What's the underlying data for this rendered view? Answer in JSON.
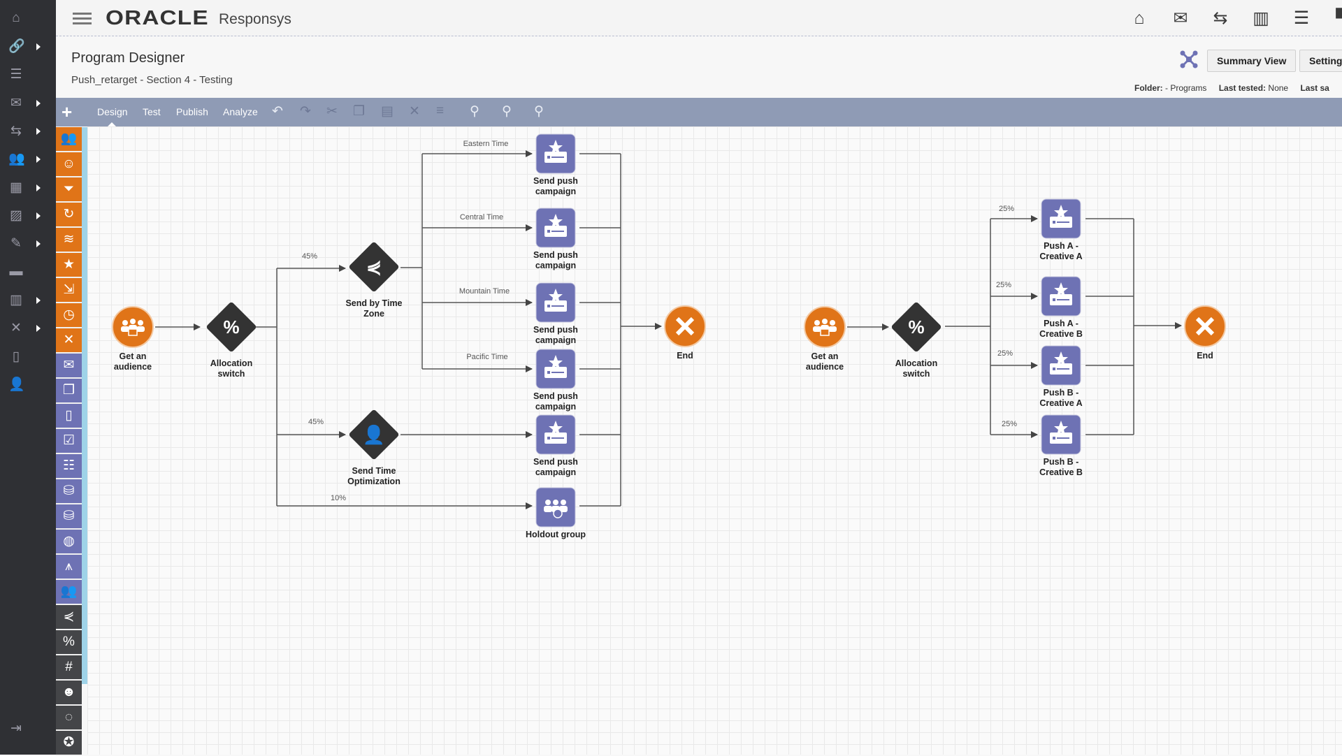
{
  "sidebar": {
    "items": [
      {
        "icon": "home-icon",
        "glyph": "⌂",
        "arrow": false
      },
      {
        "icon": "link-icon",
        "glyph": "🔗",
        "arrow": true
      },
      {
        "icon": "tasks-icon",
        "glyph": "☰",
        "arrow": false
      },
      {
        "icon": "mail-icon",
        "glyph": "✉",
        "arrow": true
      },
      {
        "icon": "program-icon",
        "glyph": "⇆",
        "arrow": true
      },
      {
        "icon": "audience-icon",
        "glyph": "👥",
        "arrow": true
      },
      {
        "icon": "table-icon",
        "glyph": "▦",
        "arrow": true
      },
      {
        "icon": "image-icon",
        "glyph": "▨",
        "arrow": true
      },
      {
        "icon": "document-icon",
        "glyph": "✎",
        "arrow": true
      },
      {
        "icon": "folder-icon",
        "glyph": "▬",
        "arrow": false
      },
      {
        "icon": "chart-icon",
        "glyph": "▥",
        "arrow": true
      },
      {
        "icon": "tools-icon",
        "glyph": "✕",
        "arrow": true
      },
      {
        "icon": "mobile-icon",
        "glyph": "▯",
        "arrow": false
      },
      {
        "icon": "user-icon",
        "glyph": "👤",
        "arrow": false
      }
    ],
    "logout_icon": "logout-icon"
  },
  "header": {
    "brand": "ORACLE",
    "product": "Responsys",
    "icons": [
      "home-icon",
      "mail-icon",
      "program-icon",
      "chart-icon",
      "tasks-icon",
      "chat-icon"
    ]
  },
  "page": {
    "title": "Program Designer",
    "subtitle": "Push_retarget - Section 4 - Testing"
  },
  "actions": {
    "summary_view": "Summary View",
    "settings": "Settings",
    "layout_icon": "auto-layout-icon"
  },
  "meta": {
    "folder_label": "Folder:",
    "folder_value": "- Programs",
    "last_tested_label": "Last tested:",
    "last_tested_value": "None",
    "last_saved_label": "Last sa"
  },
  "toolbar": {
    "tabs": [
      "Design",
      "Test",
      "Publish",
      "Analyze"
    ],
    "active_tab": "Design",
    "tools": [
      "add-icon",
      "undo-icon",
      "redo-icon",
      "cut-icon",
      "copy-icon",
      "paste-icon",
      "delete-icon",
      "align-icon",
      "zoom-icon",
      "zoom-in-icon",
      "zoom-out-icon"
    ]
  },
  "palette": {
    "orange": [
      "audience-icon",
      "profile-icon",
      "filter-icon",
      "refresh-audience-icon",
      "push-signal-icon",
      "star-icon",
      "program-flow-icon",
      "timer-icon",
      "end-icon"
    ],
    "purple": [
      "mail-icon",
      "display-icon",
      "mobile-icon",
      "clipboard-icon",
      "data-tree-icon",
      "database-check-icon",
      "database-arrow-icon",
      "globe-icon",
      "compass-icon",
      "holdout-group-icon"
    ],
    "dark": [
      "split-icon",
      "percent-icon",
      "hash-icon",
      "brain-icon",
      "cycle-icon",
      "award-icon"
    ],
    "colors": {
      "orange": "#e07418",
      "purple": "#6e72b4",
      "dark": "#444548"
    }
  },
  "diagram": {
    "colors": {
      "start": "#e07418",
      "campaign": "#6e72b4",
      "switch": "#333333",
      "end": "#e07418",
      "line": "#555555"
    },
    "program1": {
      "audience": [
        "Get an",
        "audience"
      ],
      "allocation": [
        "Allocation",
        "switch"
      ],
      "time_zone": [
        "Send by Time",
        "Zone"
      ],
      "sto": [
        "Send Time",
        "Optimization"
      ],
      "campaigns": [
        [
          "Send push",
          "campaign"
        ],
        [
          "Send push",
          "campaign"
        ],
        [
          "Send push",
          "campaign"
        ],
        [
          "Send push",
          "campaign"
        ],
        [
          "Send push",
          "campaign"
        ]
      ],
      "holdout": [
        "Holdout group"
      ],
      "end": [
        "End"
      ],
      "alloc_labels": [
        "45%",
        "45%",
        "10%"
      ],
      "tz_labels": [
        "Eastern Time",
        "Central Time",
        "Mountain Time",
        "Pacific Time"
      ]
    },
    "program2": {
      "audience": [
        "Get an",
        "audience"
      ],
      "allocation": [
        "Allocation",
        "switch"
      ],
      "campaigns": [
        [
          "Push A -",
          "Creative A"
        ],
        [
          "Push A -",
          "Creative B"
        ],
        [
          "Push B -",
          "Creative A"
        ],
        [
          "Push B -",
          "Creative B"
        ]
      ],
      "end": [
        "End"
      ],
      "alloc_labels": [
        "25%",
        "25%",
        "25%",
        "25%"
      ]
    }
  }
}
